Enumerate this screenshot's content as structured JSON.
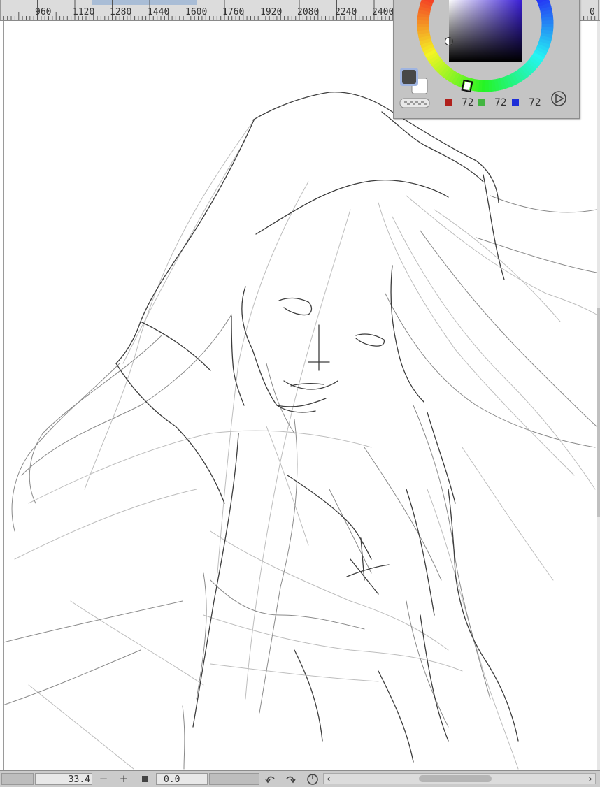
{
  "ruler": {
    "labels": [
      "960",
      "1120",
      "1280",
      "1440",
      "1600",
      "1760",
      "1920",
      "2080",
      "2240",
      "2400",
      "0"
    ]
  },
  "color_panel": {
    "main_color": "#484848",
    "sub_color": "#ffffff",
    "hue_marker_color": "#4b2bff",
    "rgb": {
      "r_value": "72",
      "g_value": "72",
      "b_value": "72",
      "r_color": "#b0201c",
      "g_color": "#42b540",
      "b_color": "#1d2ed8"
    }
  },
  "bottom_bar": {
    "zoom_value": "33.4",
    "zoom_out_label": "−",
    "zoom_in_label": "+",
    "rotation_value": "0.0",
    "scroll_left_label": "‹",
    "scroll_right_label": "›"
  },
  "icons": {
    "undo": "undo-arrow-icon",
    "redo": "redo-arrow-icon",
    "reset_rotation": "rotation-reset-icon",
    "play": "play-icon",
    "stop": "square-icon"
  }
}
